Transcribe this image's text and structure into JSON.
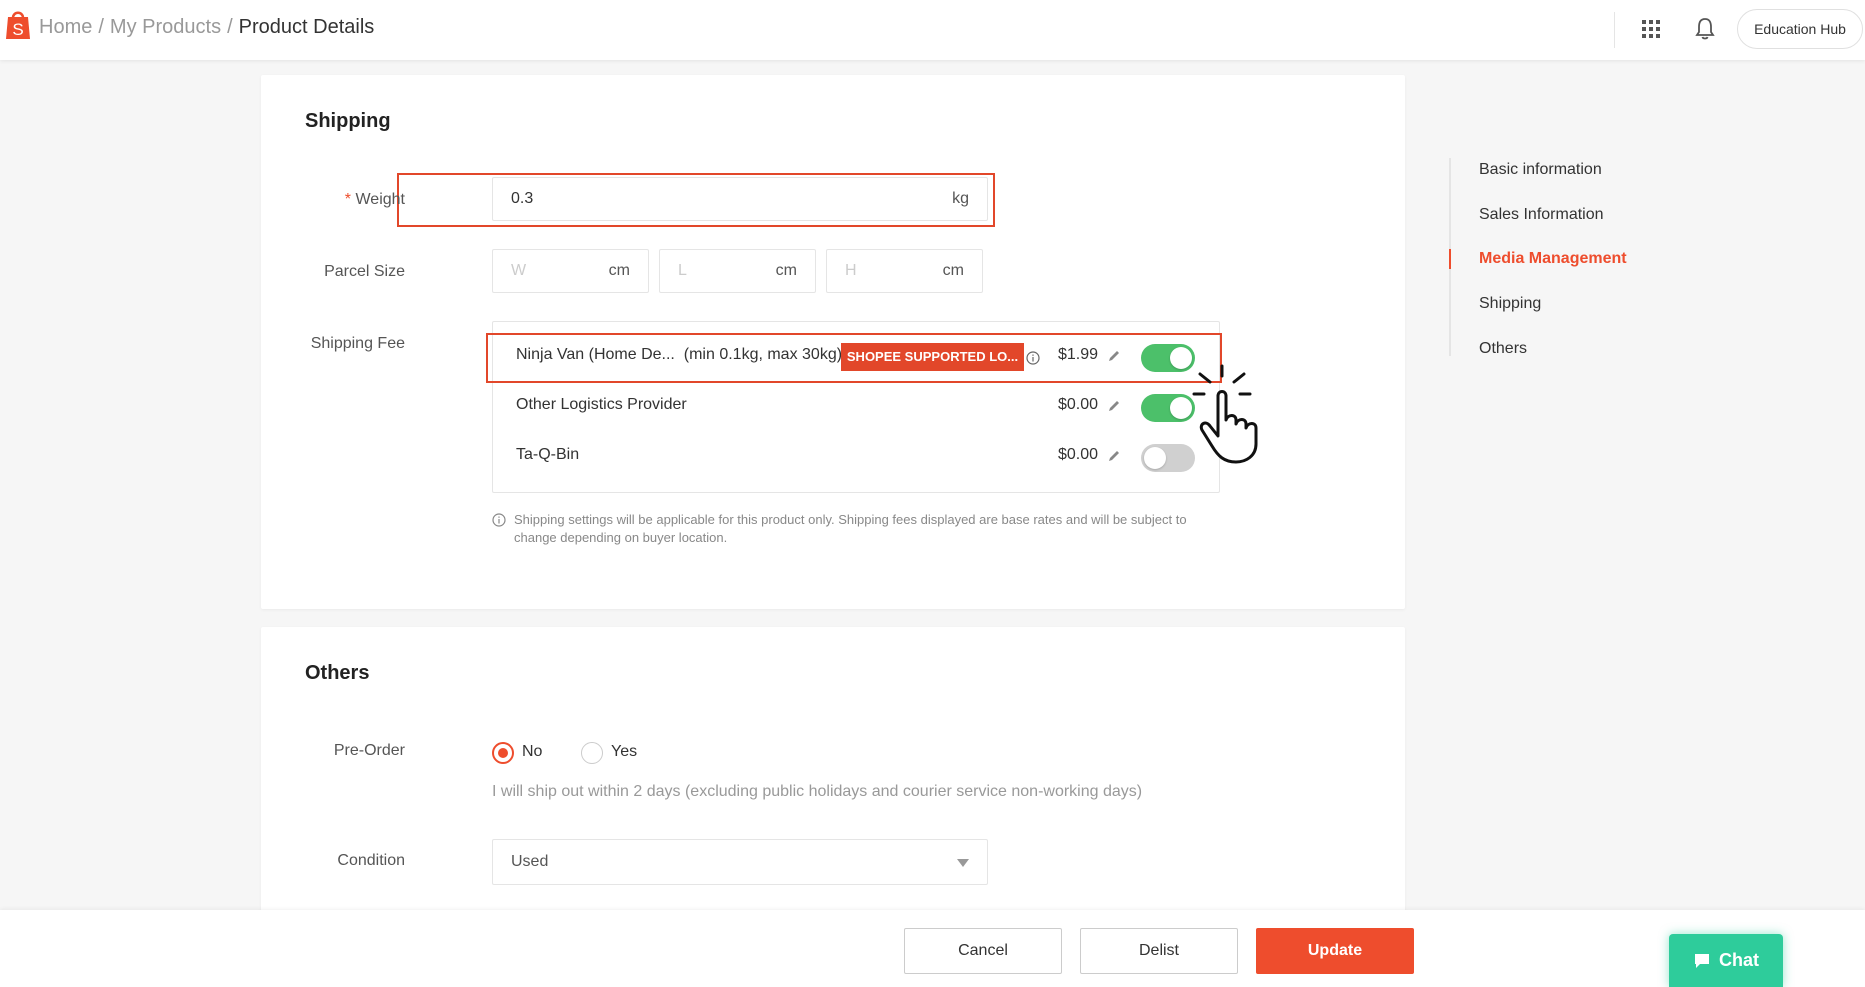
{
  "header": {
    "breadcrumbs": [
      "Home",
      "My Products",
      "Product Details"
    ],
    "separator": "/",
    "education_hub": "Education Hub",
    "brand_color": "#ee4d2d"
  },
  "shipping": {
    "title": "Shipping",
    "weight": {
      "label": "Weight",
      "required_mark": "*",
      "value": "0.3",
      "unit": "kg"
    },
    "parcel_size": {
      "label": "Parcel Size",
      "fields": [
        {
          "placeholder": "W",
          "unit": "cm"
        },
        {
          "placeholder": "L",
          "unit": "cm"
        },
        {
          "placeholder": "H",
          "unit": "cm"
        }
      ]
    },
    "shipping_fee": {
      "label": "Shipping Fee",
      "rows": [
        {
          "name": "Ninja Van (Home De...",
          "range": "(min 0.1kg, max 30kg)",
          "badge": "SHOPEE SUPPORTED LO...",
          "price": "$1.99",
          "enabled": true
        },
        {
          "name": "Other Logistics Provider",
          "price": "$0.00",
          "enabled": true
        },
        {
          "name": "Ta-Q-Bin",
          "price": "$0.00",
          "enabled": false
        }
      ]
    },
    "note": "Shipping settings will be applicable for this product only. Shipping fees displayed are base rates and will be subject to change depending on buyer location."
  },
  "others": {
    "title": "Others",
    "pre_order": {
      "label": "Pre-Order",
      "options": [
        "No",
        "Yes"
      ],
      "selected": "No",
      "hint": "I will ship out within 2 days (excluding public holidays and courier service non-working days)"
    },
    "condition": {
      "label": "Condition",
      "value": "Used"
    }
  },
  "sidenav": {
    "items": [
      "Basic information",
      "Sales Information",
      "Media Management",
      "Shipping",
      "Others"
    ],
    "active": "Media Management"
  },
  "footer": {
    "cancel": "Cancel",
    "delist": "Delist",
    "update": "Update",
    "chat": "Chat"
  }
}
